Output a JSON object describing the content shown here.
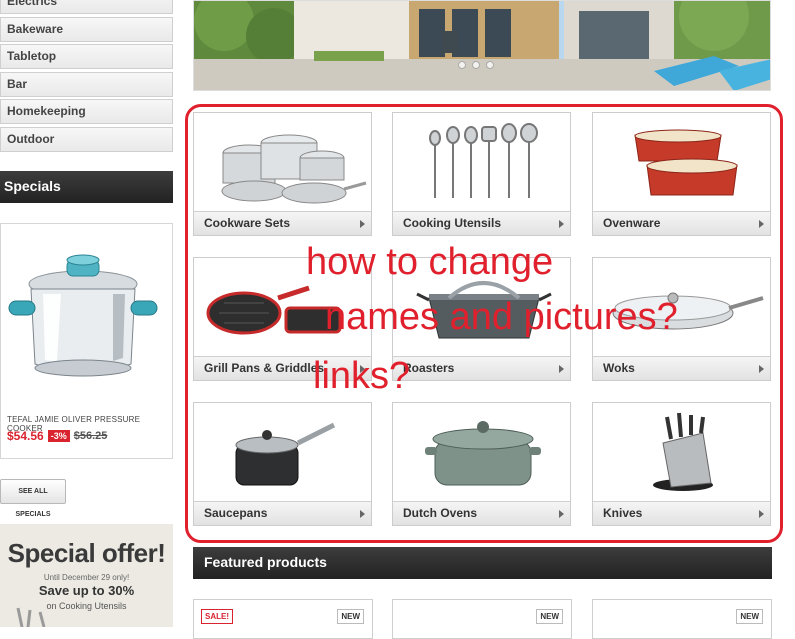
{
  "sidebar": {
    "categories": [
      "Electrics",
      "Bakeware",
      "Tabletop",
      "Bar",
      "Homekeeping",
      "Outdoor"
    ],
    "specials_title": "Specials",
    "special_product": {
      "name": "TEFAL JAMIE OLIVER PRESSURE COOKER",
      "price": "$54.56",
      "discount": "-3%",
      "old_price": "$56.25"
    },
    "see_all_label": "SEE ALL SPECIALS",
    "offer": {
      "title": "Special offer!",
      "until": "Until December 29 only!",
      "save": "Save up to 30%",
      "on": "on Cooking Utensils"
    }
  },
  "grid": {
    "items": [
      {
        "label": "Cookware Sets"
      },
      {
        "label": "Cooking Utensils"
      },
      {
        "label": "Ovenware"
      },
      {
        "label": "Grill Pans & Griddles"
      },
      {
        "label": "Roasters"
      },
      {
        "label": "Woks"
      },
      {
        "label": "Saucepans"
      },
      {
        "label": "Dutch Ovens"
      },
      {
        "label": "Knives"
      }
    ]
  },
  "annotation": {
    "line1": "how to change",
    "line2": "names and pictures?",
    "line3": "links?"
  },
  "featured": {
    "title": "Featured products",
    "badge_sale": "SALE!",
    "badge_new": "NEW"
  },
  "colors": {
    "accent_red": "#e0202c",
    "header_dark": "#2a2a2a"
  }
}
